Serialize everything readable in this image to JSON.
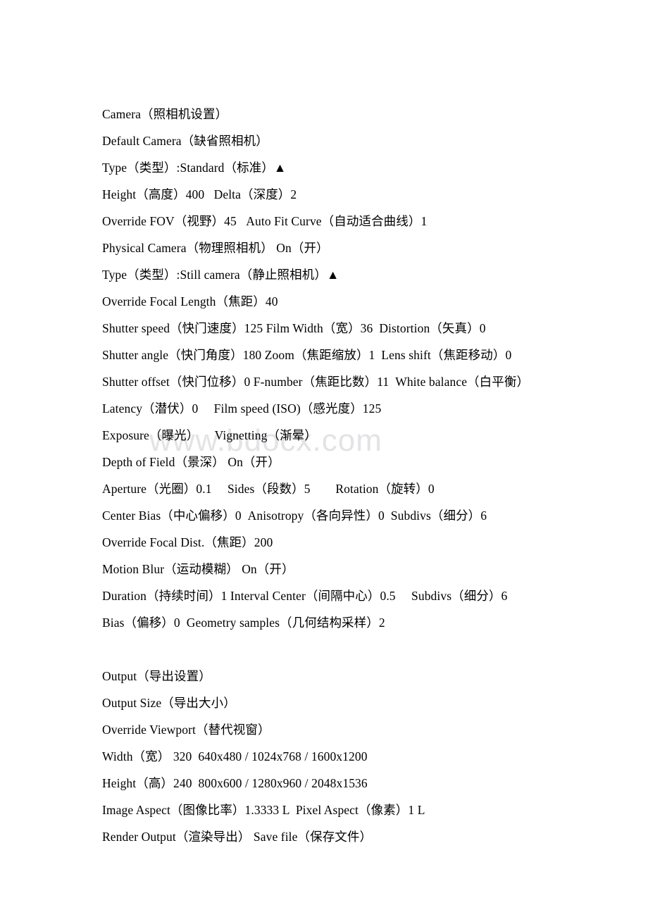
{
  "document": {
    "watermark": "www.bdocx.com",
    "background_color": "#ffffff",
    "text_color": "#000000",
    "watermark_color": "#e3e3e6",
    "sections": [
      {
        "name": "camera",
        "lines": [
          "Camera（照相机设置）",
          "Default Camera（缺省照相机）",
          "Type（类型）:Standard（标准）▲",
          "Height（高度）400   Delta（深度）2",
          "Override FOV（视野）45   Auto Fit Curve（自动适合曲线）1",
          "Physical Camera（物理照相机） On（开）",
          "Type（类型）:Still camera（静止照相机）▲",
          "Override Focal Length（焦距）40",
          "Shutter speed（快门速度）125 Film Width（宽）36  Distortion（矢真）0",
          "Shutter angle（快门角度）180 Zoom（焦距缩放）1  Lens shift（焦距移动）0",
          "Shutter offset（快门位移）0 F-number（焦距比数）11  White balance（白平衡）",
          "Latency（潜伏）0     Film speed (ISO)（感光度）125",
          "Exposure（曝光）     Vignetting（渐晕）",
          "Depth of Field（景深） On（开）",
          "Aperture（光圈）0.1     Sides（段数）5        Rotation（旋转）0",
          "Center Bias（中心偏移）0  Anisotropy（各向异性）0  Subdivs（细分）6",
          "Override Focal Dist.（焦距）200",
          "Motion Blur（运动模糊） On（开）",
          "Duration（持续时间）1 Interval Center（间隔中心）0.5     Subdivs（细分）6",
          "Bias（偏移）0  Geometry samples（几何结构采样）2"
        ]
      },
      {
        "name": "spacer",
        "lines": [
          ""
        ]
      },
      {
        "name": "output",
        "lines": [
          "Output（导出设置）",
          "Output Size（导出大小）",
          "Override Viewport（替代视窗）",
          "Width（宽） 320  640x480 / 1024x768 / 1600x1200",
          "Height（高）240  800x600 / 1280x960 / 2048x1536",
          "Image Aspect（图像比率）1.3333 L  Pixel Aspect（像素）1 L",
          "Render Output（渲染导出） Save file（保存文件）"
        ]
      }
    ]
  }
}
